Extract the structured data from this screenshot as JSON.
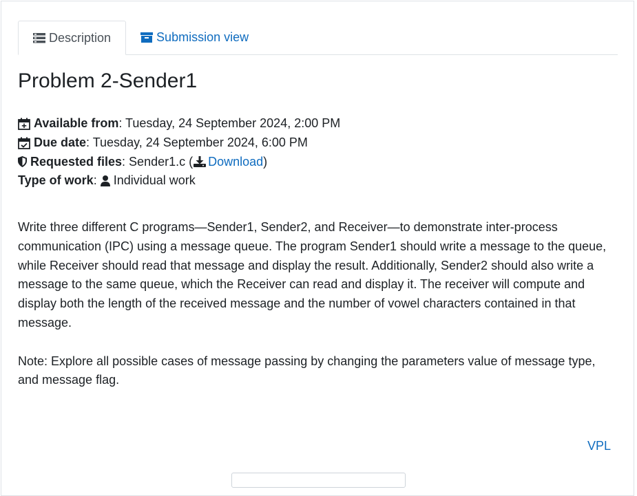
{
  "tabs": [
    {
      "label": "Description",
      "icon": "list-icon",
      "active": true
    },
    {
      "label": "Submission view",
      "icon": "archive-icon",
      "active": false
    }
  ],
  "activity": {
    "title": "Problem 2-Sender1",
    "available_from_label": "Available from",
    "available_from_value": ": Tuesday, 24 September 2024, 2:00 PM",
    "due_date_label": "Due date",
    "due_date_value": ": Tuesday, 24 September 2024, 6:00 PM",
    "requested_files_label": "Requested files",
    "requested_files_value": ": Sender1.c (",
    "download_label": "Download",
    "requested_files_close": ")",
    "type_of_work_label": "Type of work",
    "type_of_work_sep": ":",
    "type_of_work_value": "Individual work"
  },
  "description": {
    "paragraph1": "Write three  different C programs—Sender1, Sender2, and Receiver—to demonstrate inter-process communication (IPC) using a message queue. The program Sender1 should write a message to the queue, while Receiver should read that message and display the result. Additionally, Sender2 should also write a message to the same queue, which the Receiver can read and display it. The receiver will compute and display both the length of the received message and the number of vowel characters contained in that message.",
    "paragraph2": "Note: Explore all possible cases of message passing by changing the parameters value of message type, and message flag."
  },
  "footer": {
    "vpl_link": "VPL"
  },
  "colors": {
    "link": "#0f6cbf",
    "text": "#1d2125",
    "border": "#dee2e6"
  }
}
